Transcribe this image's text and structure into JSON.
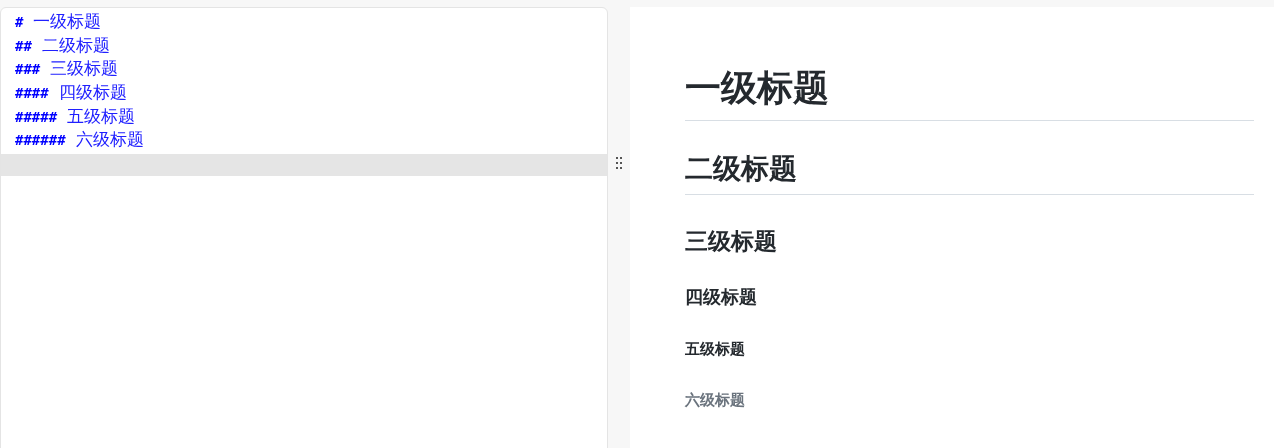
{
  "editor": {
    "lines": [
      {
        "marker": "#",
        "text": "一级标题"
      },
      {
        "marker": "##",
        "text": "二级标题"
      },
      {
        "marker": "###",
        "text": "三级标题"
      },
      {
        "marker": "####",
        "text": "四级标题"
      },
      {
        "marker": "#####",
        "text": "五级标题"
      },
      {
        "marker": "######",
        "text": "六级标题"
      }
    ],
    "cursor_line_active": true
  },
  "preview": {
    "headings": [
      {
        "kind": "h1",
        "text": "一级标题"
      },
      {
        "kind": "h2",
        "text": "二级标题"
      },
      {
        "kind": "h3",
        "text": "三级标题"
      },
      {
        "kind": "h4",
        "text": "四级标题"
      },
      {
        "kind": "h5",
        "text": "五级标题"
      },
      {
        "kind": "h6",
        "text": "六级标题"
      }
    ]
  }
}
